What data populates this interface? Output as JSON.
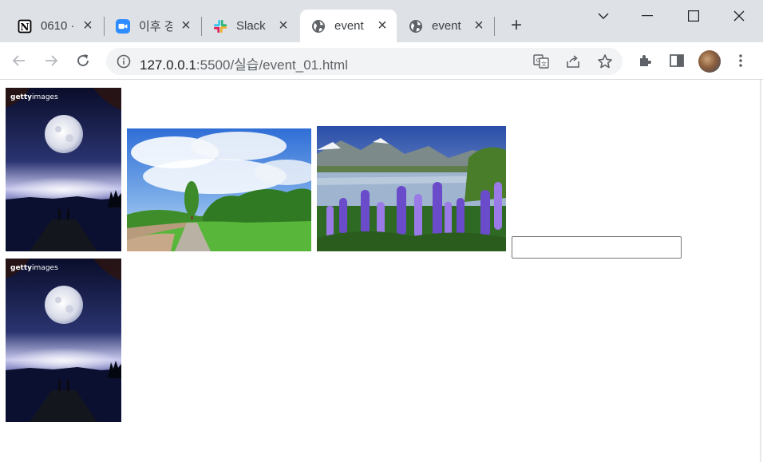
{
  "tabs": [
    {
      "title": "0610 ·",
      "favicon": "notion-icon",
      "active": false
    },
    {
      "title": "이후 경",
      "favicon": "zoom-icon",
      "active": false
    },
    {
      "title": "Slack |",
      "favicon": "slack-icon",
      "active": false
    },
    {
      "title": "event",
      "favicon": "globe-icon",
      "active": true
    },
    {
      "title": "event",
      "favicon": "globe-icon",
      "active": false
    }
  ],
  "address": {
    "host": "127.0.0.1",
    "path": ":5500/실습/event_01.html"
  },
  "images": [
    {
      "name": "moon-image-1",
      "watermark": "gettyimages",
      "subject": "moonlit pier"
    },
    {
      "name": "meadow-image",
      "subject": "green field with path and blue sky"
    },
    {
      "name": "lupine-image",
      "subject": "purple lupines by mountain lake"
    },
    {
      "name": "moon-image-2",
      "watermark": "gettyimages",
      "subject": "moonlit pier"
    }
  ],
  "input": {
    "value": "",
    "placeholder": ""
  },
  "colors": {
    "tabbar": "#dee1e6",
    "omnibox": "#f1f3f4",
    "zoom_blue": "#2d8cff"
  }
}
